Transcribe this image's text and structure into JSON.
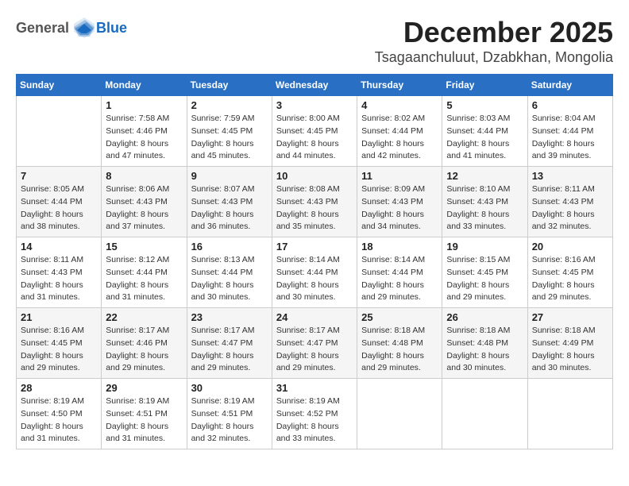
{
  "header": {
    "logo": {
      "general": "General",
      "blue": "Blue"
    },
    "title": "December 2025",
    "location": "Tsagaanchuluut, Dzabkhan, Mongolia"
  },
  "weekdays": [
    "Sunday",
    "Monday",
    "Tuesday",
    "Wednesday",
    "Thursday",
    "Friday",
    "Saturday"
  ],
  "weeks": [
    [
      {
        "day": "",
        "sunrise": "",
        "sunset": "",
        "daylight": ""
      },
      {
        "day": "1",
        "sunrise": "Sunrise: 7:58 AM",
        "sunset": "Sunset: 4:46 PM",
        "daylight": "Daylight: 8 hours and 47 minutes."
      },
      {
        "day": "2",
        "sunrise": "Sunrise: 7:59 AM",
        "sunset": "Sunset: 4:45 PM",
        "daylight": "Daylight: 8 hours and 45 minutes."
      },
      {
        "day": "3",
        "sunrise": "Sunrise: 8:00 AM",
        "sunset": "Sunset: 4:45 PM",
        "daylight": "Daylight: 8 hours and 44 minutes."
      },
      {
        "day": "4",
        "sunrise": "Sunrise: 8:02 AM",
        "sunset": "Sunset: 4:44 PM",
        "daylight": "Daylight: 8 hours and 42 minutes."
      },
      {
        "day": "5",
        "sunrise": "Sunrise: 8:03 AM",
        "sunset": "Sunset: 4:44 PM",
        "daylight": "Daylight: 8 hours and 41 minutes."
      },
      {
        "day": "6",
        "sunrise": "Sunrise: 8:04 AM",
        "sunset": "Sunset: 4:44 PM",
        "daylight": "Daylight: 8 hours and 39 minutes."
      }
    ],
    [
      {
        "day": "7",
        "sunrise": "Sunrise: 8:05 AM",
        "sunset": "Sunset: 4:44 PM",
        "daylight": "Daylight: 8 hours and 38 minutes."
      },
      {
        "day": "8",
        "sunrise": "Sunrise: 8:06 AM",
        "sunset": "Sunset: 4:43 PM",
        "daylight": "Daylight: 8 hours and 37 minutes."
      },
      {
        "day": "9",
        "sunrise": "Sunrise: 8:07 AM",
        "sunset": "Sunset: 4:43 PM",
        "daylight": "Daylight: 8 hours and 36 minutes."
      },
      {
        "day": "10",
        "sunrise": "Sunrise: 8:08 AM",
        "sunset": "Sunset: 4:43 PM",
        "daylight": "Daylight: 8 hours and 35 minutes."
      },
      {
        "day": "11",
        "sunrise": "Sunrise: 8:09 AM",
        "sunset": "Sunset: 4:43 PM",
        "daylight": "Daylight: 8 hours and 34 minutes."
      },
      {
        "day": "12",
        "sunrise": "Sunrise: 8:10 AM",
        "sunset": "Sunset: 4:43 PM",
        "daylight": "Daylight: 8 hours and 33 minutes."
      },
      {
        "day": "13",
        "sunrise": "Sunrise: 8:11 AM",
        "sunset": "Sunset: 4:43 PM",
        "daylight": "Daylight: 8 hours and 32 minutes."
      }
    ],
    [
      {
        "day": "14",
        "sunrise": "Sunrise: 8:11 AM",
        "sunset": "Sunset: 4:43 PM",
        "daylight": "Daylight: 8 hours and 31 minutes."
      },
      {
        "day": "15",
        "sunrise": "Sunrise: 8:12 AM",
        "sunset": "Sunset: 4:44 PM",
        "daylight": "Daylight: 8 hours and 31 minutes."
      },
      {
        "day": "16",
        "sunrise": "Sunrise: 8:13 AM",
        "sunset": "Sunset: 4:44 PM",
        "daylight": "Daylight: 8 hours and 30 minutes."
      },
      {
        "day": "17",
        "sunrise": "Sunrise: 8:14 AM",
        "sunset": "Sunset: 4:44 PM",
        "daylight": "Daylight: 8 hours and 30 minutes."
      },
      {
        "day": "18",
        "sunrise": "Sunrise: 8:14 AM",
        "sunset": "Sunset: 4:44 PM",
        "daylight": "Daylight: 8 hours and 29 minutes."
      },
      {
        "day": "19",
        "sunrise": "Sunrise: 8:15 AM",
        "sunset": "Sunset: 4:45 PM",
        "daylight": "Daylight: 8 hours and 29 minutes."
      },
      {
        "day": "20",
        "sunrise": "Sunrise: 8:16 AM",
        "sunset": "Sunset: 4:45 PM",
        "daylight": "Daylight: 8 hours and 29 minutes."
      }
    ],
    [
      {
        "day": "21",
        "sunrise": "Sunrise: 8:16 AM",
        "sunset": "Sunset: 4:45 PM",
        "daylight": "Daylight: 8 hours and 29 minutes."
      },
      {
        "day": "22",
        "sunrise": "Sunrise: 8:17 AM",
        "sunset": "Sunset: 4:46 PM",
        "daylight": "Daylight: 8 hours and 29 minutes."
      },
      {
        "day": "23",
        "sunrise": "Sunrise: 8:17 AM",
        "sunset": "Sunset: 4:47 PM",
        "daylight": "Daylight: 8 hours and 29 minutes."
      },
      {
        "day": "24",
        "sunrise": "Sunrise: 8:17 AM",
        "sunset": "Sunset: 4:47 PM",
        "daylight": "Daylight: 8 hours and 29 minutes."
      },
      {
        "day": "25",
        "sunrise": "Sunrise: 8:18 AM",
        "sunset": "Sunset: 4:48 PM",
        "daylight": "Daylight: 8 hours and 29 minutes."
      },
      {
        "day": "26",
        "sunrise": "Sunrise: 8:18 AM",
        "sunset": "Sunset: 4:48 PM",
        "daylight": "Daylight: 8 hours and 30 minutes."
      },
      {
        "day": "27",
        "sunrise": "Sunrise: 8:18 AM",
        "sunset": "Sunset: 4:49 PM",
        "daylight": "Daylight: 8 hours and 30 minutes."
      }
    ],
    [
      {
        "day": "28",
        "sunrise": "Sunrise: 8:19 AM",
        "sunset": "Sunset: 4:50 PM",
        "daylight": "Daylight: 8 hours and 31 minutes."
      },
      {
        "day": "29",
        "sunrise": "Sunrise: 8:19 AM",
        "sunset": "Sunset: 4:51 PM",
        "daylight": "Daylight: 8 hours and 31 minutes."
      },
      {
        "day": "30",
        "sunrise": "Sunrise: 8:19 AM",
        "sunset": "Sunset: 4:51 PM",
        "daylight": "Daylight: 8 hours and 32 minutes."
      },
      {
        "day": "31",
        "sunrise": "Sunrise: 8:19 AM",
        "sunset": "Sunset: 4:52 PM",
        "daylight": "Daylight: 8 hours and 33 minutes."
      },
      {
        "day": "",
        "sunrise": "",
        "sunset": "",
        "daylight": ""
      },
      {
        "day": "",
        "sunrise": "",
        "sunset": "",
        "daylight": ""
      },
      {
        "day": "",
        "sunrise": "",
        "sunset": "",
        "daylight": ""
      }
    ]
  ]
}
